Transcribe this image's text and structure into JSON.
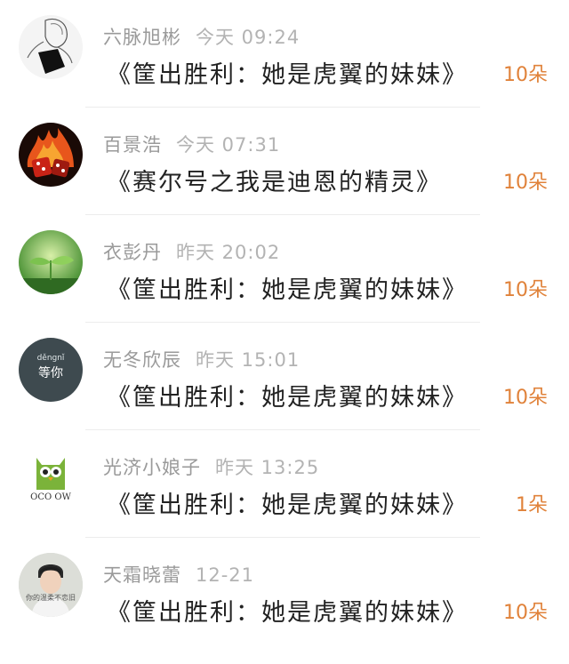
{
  "items": [
    {
      "username": "六脉旭彬",
      "time": "今天 09:24",
      "title": "《筐出胜利：她是虎翼的妹妹》",
      "count": "10朵",
      "avatar_icon": "sketch-person-avatar",
      "avatar_color": "#e9e9e9"
    },
    {
      "username": "百景浩",
      "time": "今天 07:31",
      "title": "《赛尔号之我是迪恩的精灵》",
      "count": "10朵",
      "avatar_icon": "fire-dice-avatar",
      "avatar_color": "#c8361a"
    },
    {
      "username": "衣彭丹",
      "time": "昨天 20:02",
      "title": "《筐出胜利：她是虎翼的妹妹》",
      "count": "10朵",
      "avatar_icon": "green-sprout-avatar",
      "avatar_color": "#6fb24a"
    },
    {
      "username": "无冬欣辰",
      "time": "昨天 15:01",
      "title": "《筐出胜利：她是虎翼的妹妹》",
      "count": "10朵",
      "avatar_icon": "dengni-text-avatar",
      "avatar_color": "#3e4a4f",
      "avatar_text_top": "děngnǐ",
      "avatar_text_main": "等你"
    },
    {
      "username": "光济小娘子",
      "time": "昨天 13:25",
      "title": "《筐出胜利：她是虎翼的妹妹》",
      "count": "1朵",
      "avatar_icon": "owl-avatar",
      "avatar_color": "#8cbf3f",
      "avatar_text_main": "OCO OW"
    },
    {
      "username": "天霜晓蕾",
      "time": "12-21",
      "title": "《筐出胜利：她是虎翼的妹妹》",
      "count": "10朵",
      "avatar_icon": "boy-photo-avatar",
      "avatar_color": "#d9dbd6",
      "avatar_text_main": "你的温柔不恋旧"
    }
  ]
}
